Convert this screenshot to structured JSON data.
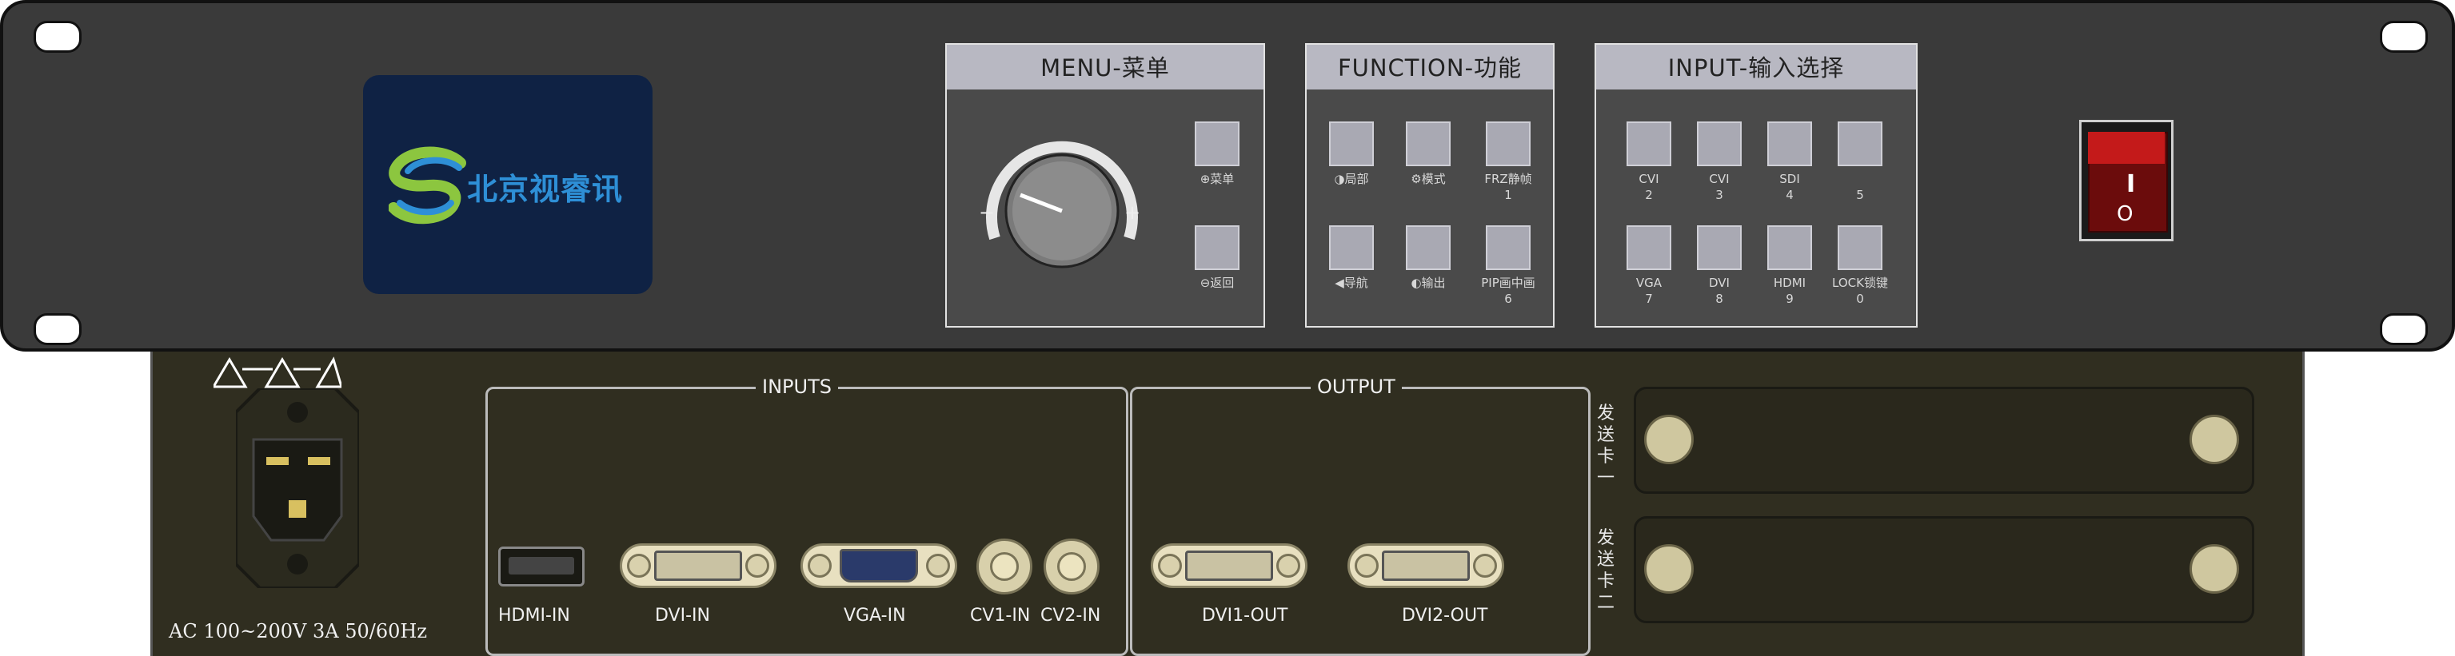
{
  "front": {
    "brand": "北京视睿讯",
    "menu_group": {
      "title": "MENU-菜单",
      "knob_minus": "−",
      "knob_plus": "+",
      "keys": [
        {
          "label": "⊕菜单"
        },
        {
          "label": "⊖返回"
        }
      ]
    },
    "function_group": {
      "title": "FUNCTION-功能",
      "keys": [
        {
          "label": "◑局部"
        },
        {
          "label": "⚙模式"
        },
        {
          "label": "FRZ静帧",
          "num": "1"
        },
        {
          "label": "◀导航"
        },
        {
          "label": "◐输出"
        },
        {
          "label": "PIP画中画",
          "num": "6"
        }
      ]
    },
    "input_group": {
      "title": "INPUT-输入选择",
      "keys": [
        {
          "label": "CVI",
          "num": "2"
        },
        {
          "label": "CVI",
          "num": "3"
        },
        {
          "label": "SDI",
          "num": "4"
        },
        {
          "label": "",
          "num": "5"
        },
        {
          "label": "VGA",
          "num": "7"
        },
        {
          "label": "DVI",
          "num": "8"
        },
        {
          "label": "HDMI",
          "num": "9"
        },
        {
          "label": "LOCK锁键",
          "num": "0"
        }
      ]
    },
    "power_switch": {
      "on": "I",
      "off": "O"
    }
  },
  "rear": {
    "power_spec": "AC 100~200V 3A 50/60Hz",
    "inputs_title": "INPUTS",
    "output_title": "OUTPUT",
    "ports": {
      "hdmi_in": "HDMI-IN",
      "dvi_in": "DVI-IN",
      "vga_in": "VGA-IN",
      "cv1_in": "CV1-IN",
      "cv2_in": "CV2-IN",
      "dvi1_out": "DVI1-OUT",
      "dvi2_out": "DVI2-OUT"
    },
    "card_slots": [
      {
        "label_chars": [
          "发",
          "送",
          "卡",
          "一"
        ]
      },
      {
        "label_chars": [
          "发",
          "送",
          "卡",
          "二"
        ]
      }
    ]
  }
}
